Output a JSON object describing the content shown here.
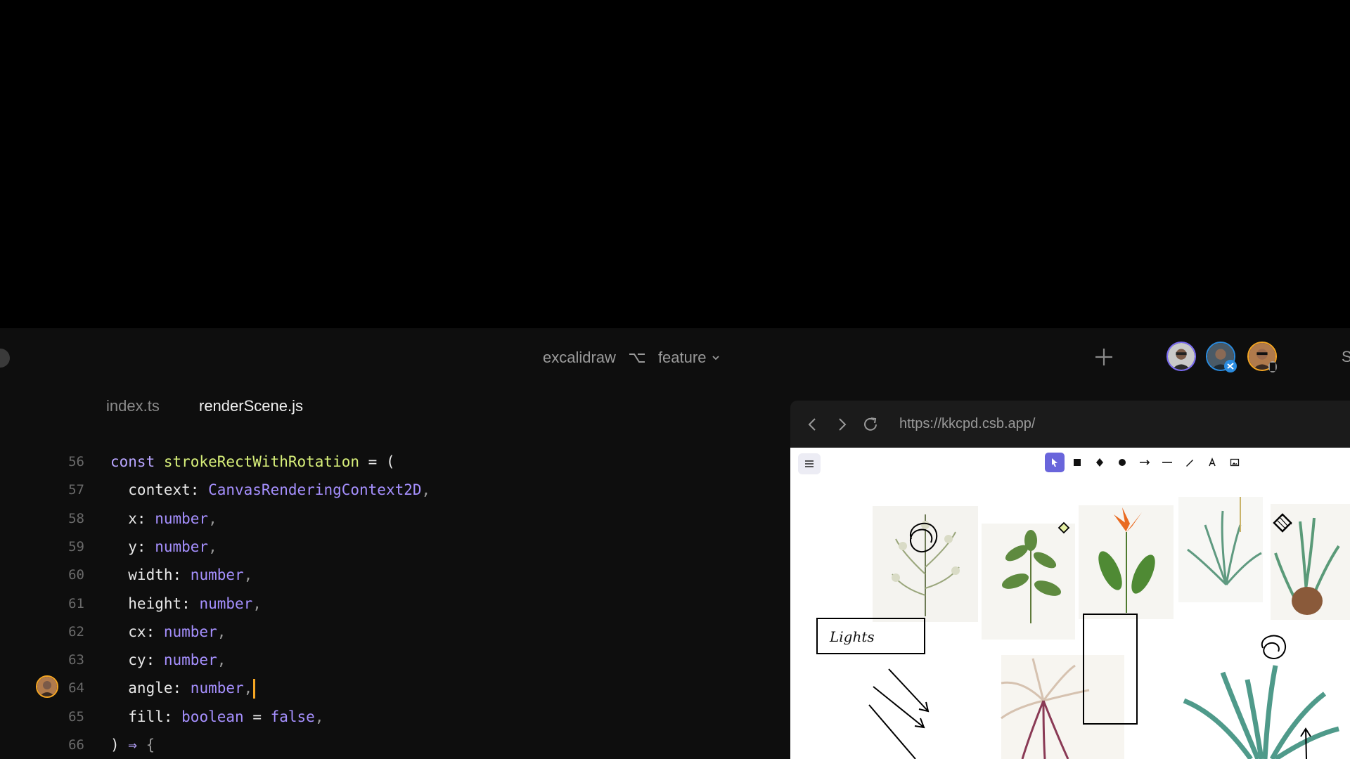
{
  "header": {
    "project_name": "excalidraw",
    "branch_name": "feature",
    "share_label_partial": "S"
  },
  "avatars": [
    {
      "name": "collaborator-1",
      "ring_color": "#7b6cf6"
    },
    {
      "name": "collaborator-2",
      "badge": "vscode-icon",
      "badge_color": "#2a8ce0"
    },
    {
      "name": "collaborator-3",
      "ring_color": "#f5a623",
      "badge": "mobile-icon"
    }
  ],
  "editor": {
    "tabs": [
      {
        "label": "index.ts",
        "active": false
      },
      {
        "label": "renderScene.js",
        "active": true
      }
    ],
    "lines": [
      {
        "num": "56",
        "tokens": [
          [
            "kw",
            "const "
          ],
          [
            "fn",
            "strokeRectWithRotation"
          ],
          [
            "tx",
            " = ("
          ]
        ]
      },
      {
        "num": "57",
        "tokens": [
          [
            "tx",
            "  context: "
          ],
          [
            "ty",
            "CanvasRenderingContext2D"
          ],
          [
            "pu",
            ","
          ]
        ]
      },
      {
        "num": "58",
        "tokens": [
          [
            "tx",
            "  x: "
          ],
          [
            "ty",
            "number"
          ],
          [
            "pu",
            ","
          ]
        ]
      },
      {
        "num": "59",
        "tokens": [
          [
            "tx",
            "  y: "
          ],
          [
            "ty",
            "number"
          ],
          [
            "pu",
            ","
          ]
        ]
      },
      {
        "num": "60",
        "tokens": [
          [
            "tx",
            "  width: "
          ],
          [
            "ty",
            "number"
          ],
          [
            "pu",
            ","
          ]
        ]
      },
      {
        "num": "61",
        "tokens": [
          [
            "tx",
            "  height: "
          ],
          [
            "ty",
            "number"
          ],
          [
            "pu",
            ","
          ]
        ]
      },
      {
        "num": "62",
        "tokens": [
          [
            "tx",
            "  cx: "
          ],
          [
            "ty",
            "number"
          ],
          [
            "pu",
            ","
          ]
        ]
      },
      {
        "num": "63",
        "tokens": [
          [
            "tx",
            "  cy: "
          ],
          [
            "ty",
            "number"
          ],
          [
            "pu",
            ","
          ]
        ]
      },
      {
        "num": "64",
        "tokens": [
          [
            "tx",
            "  angle: "
          ],
          [
            "ty",
            "number"
          ],
          [
            "pu",
            ","
          ]
        ],
        "cursor": true
      },
      {
        "num": "65",
        "tokens": [
          [
            "tx",
            "  fill: "
          ],
          [
            "ty",
            "boolean"
          ],
          [
            "tx",
            " = "
          ],
          [
            "ty",
            "false"
          ],
          [
            "pu",
            ","
          ]
        ]
      },
      {
        "num": "66",
        "tokens": [
          [
            "tx",
            ") "
          ],
          [
            "kw",
            "⇒"
          ],
          [
            "tx",
            " "
          ],
          [
            "pu",
            "{"
          ]
        ]
      }
    ],
    "cursor_color": "#f5a623"
  },
  "preview": {
    "url": "https://kkcpd.csb.app/",
    "toolbar_tools": [
      "select-tool-icon",
      "rectangle-tool-icon",
      "diamond-tool-icon",
      "ellipse-tool-icon",
      "arrow-tool-icon",
      "line-tool-icon",
      "pencil-tool-icon",
      "text-tool-icon",
      "image-tool-icon"
    ],
    "active_tool": "select-tool-icon",
    "accent": "#6965db",
    "canvas_label": "Lights"
  }
}
